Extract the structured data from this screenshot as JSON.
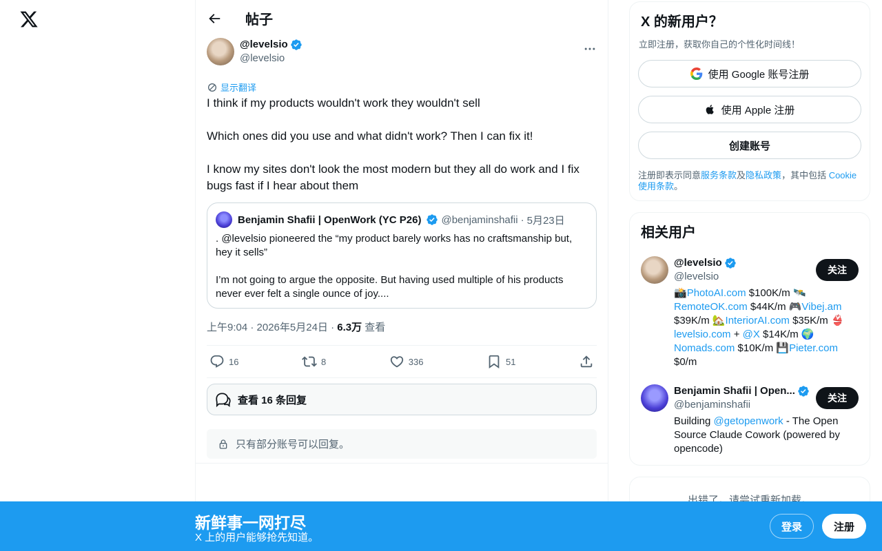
{
  "header": {
    "title": "帖子"
  },
  "post": {
    "display_name": "@levelsio",
    "handle": "@levelsio",
    "translate_label": "显示翻译",
    "text": "I think if my products wouldn't work they wouldn't sell\n\nWhich ones did you use and what didn't work? Then I can fix it!\n\nI know my sites don't look the most modern but they all do work and I fix bugs fast if I hear about them",
    "quote": {
      "display_name": "Benjamin Shafii | OpenWork (YC P26)",
      "handle": "@benjaminshafii",
      "separator": "·",
      "date": "5月23日",
      "text": ".  @levelsio pioneered the “my product barely works has no craftsmanship but, hey it sells”\n\nI’m not going to argue the opposite. But having used multiple of his products never ever felt a single ounce of joy...."
    },
    "meta": {
      "time": "上午9:04 · 2026年5月24日 · ",
      "views": "6.3万",
      "views_label": " 查看"
    },
    "actions": {
      "replies": "16",
      "reposts": "8",
      "likes": "336",
      "bookmarks": "51"
    },
    "view_replies_label": "查看 16 条回复",
    "restricted_label": "只有部分账号可以回复。"
  },
  "signup_card": {
    "title": "X 的新用户？",
    "subtitle": "立即注册，获取你自己的个性化时间线！",
    "google_label": "使用 Google 账号注册",
    "apple_label": "使用 Apple 注册",
    "create_label": "创建账号",
    "terms_prefix": "注册即表示同意",
    "terms_link": "服务条款",
    "terms_and": "及",
    "privacy_link": "隐私政策",
    "terms_mid": "，其中包括 ",
    "cookie_link": "Cookie 使用条款",
    "terms_end": "。"
  },
  "related": {
    "title": "相关用户",
    "follow_label": "关注",
    "users": [
      {
        "display_name": "@levelsio",
        "handle": "@levelsio",
        "bio": [
          {
            "t": "📸",
            "link": false
          },
          {
            "t": "PhotoAI.com",
            "link": true
          },
          {
            "t": " $100K/m 🛰️ ",
            "link": false
          },
          {
            "t": "RemoteOK.com",
            "link": true
          },
          {
            "t": " $44K/m 🎮",
            "link": false
          },
          {
            "t": "Vibej.am",
            "link": true
          },
          {
            "t": " $39K/m 🏡",
            "link": false
          },
          {
            "t": "InteriorAI.com",
            "link": true
          },
          {
            "t": " $35K/m 👙 ",
            "link": false
          },
          {
            "t": "levelsio.com",
            "link": true
          },
          {
            "t": " + ",
            "link": false
          },
          {
            "t": "@X",
            "link": true
          },
          {
            "t": " $14K/m 🌍 ",
            "link": false
          },
          {
            "t": "Nomads.com",
            "link": true
          },
          {
            "t": " $10K/m 💾",
            "link": false
          },
          {
            "t": "Pieter.com",
            "link": true
          },
          {
            "t": " $0/m",
            "link": false
          }
        ]
      },
      {
        "display_name": "Benjamin Shafii | Open...",
        "handle": "@benjaminshafii",
        "bio": [
          {
            "t": "Building ",
            "link": false
          },
          {
            "t": "@getopenwork",
            "link": true
          },
          {
            "t": " - The Open Source Claude Cowork (powered by opencode)",
            "link": false
          }
        ]
      }
    ]
  },
  "error_card": {
    "text": "出错了。请尝试重新加载。"
  },
  "banner": {
    "title": "新鲜事一网打尽",
    "subtitle": "X 上的用户能够抢先知道。",
    "login_label": "登录",
    "signup_label": "注册"
  },
  "colors": {
    "accent": "#1d9bf0",
    "text": "#0f1419",
    "muted": "#536471",
    "border": "#cfd9de"
  }
}
